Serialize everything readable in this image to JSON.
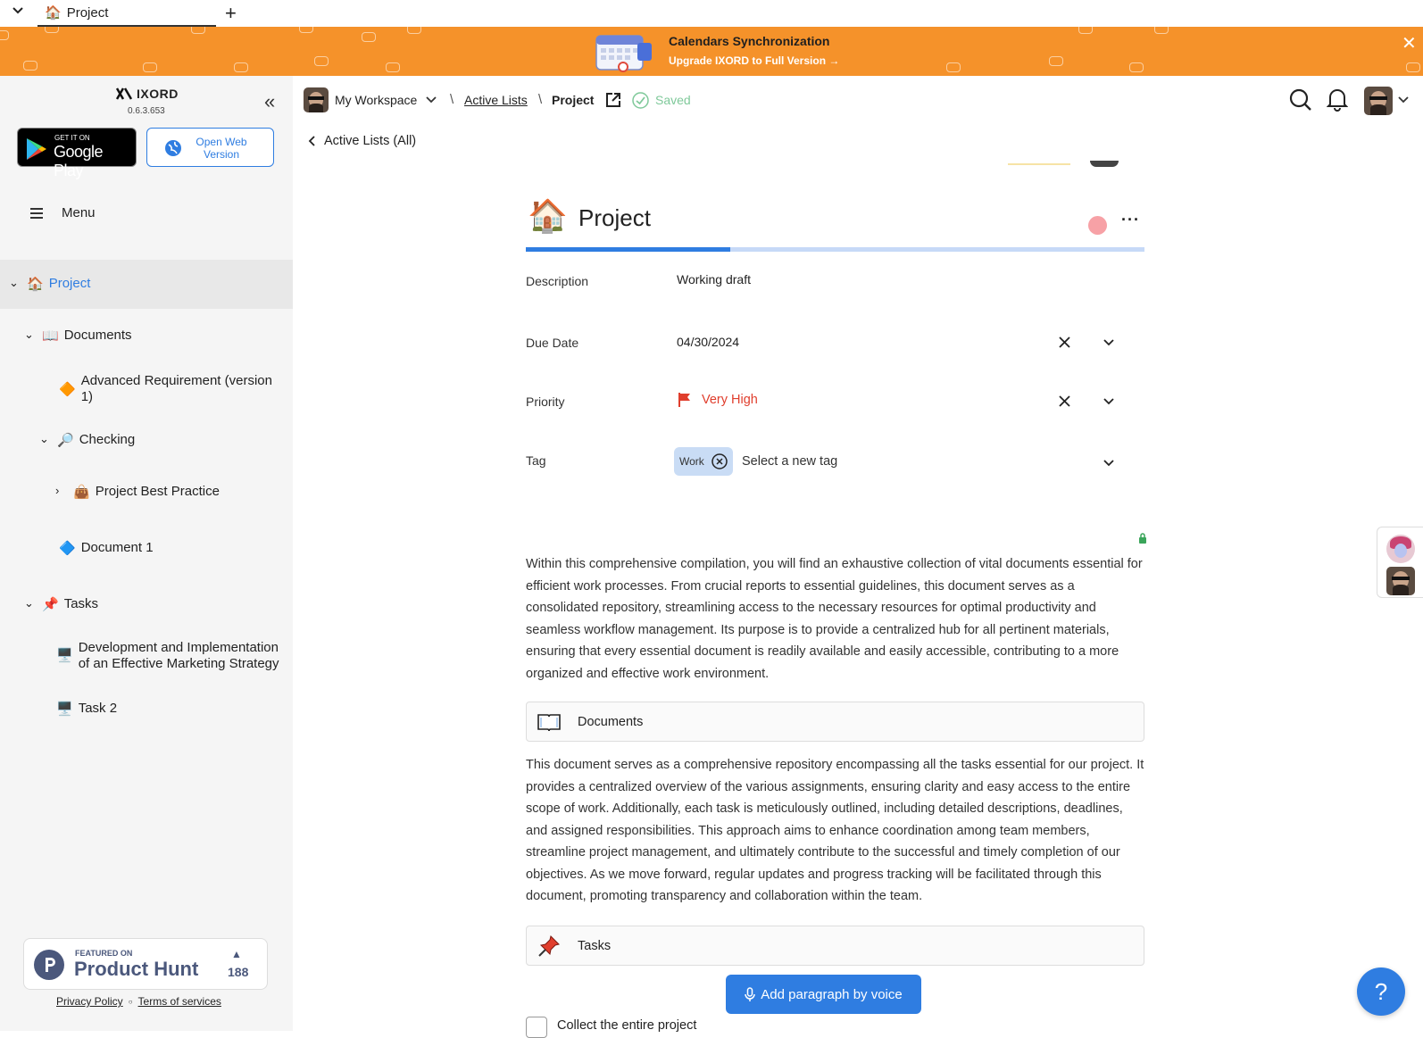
{
  "tab": {
    "icon": "house-emoji",
    "title": "Project",
    "new_tab": "+",
    "dropdown": "⌄"
  },
  "banner": {
    "title": "Calendars Synchronization",
    "subtitle": "Upgrade IXORD to Full Version",
    "color": "#f5922a"
  },
  "sidebar": {
    "app_name": "IXORD",
    "version": "0.6.3.653",
    "google_play_top": "GET IT ON",
    "google_play_bottom": "Google Play",
    "open_web_line1": "Open Web",
    "open_web_line2": "Version",
    "menu_label": "Menu",
    "tree": {
      "project": "Project",
      "documents": "Documents",
      "advanced_req": "Advanced Requirement (version 1)",
      "checking": "Checking",
      "best_practice": "Project Best Practice",
      "document1": "Document 1",
      "tasks": "Tasks",
      "dev_impl": "Development and Implementation of an Effective Marketing Strategy",
      "task2": "Task 2"
    },
    "product_hunt": {
      "featured": "FEATURED ON",
      "name": "Product Hunt",
      "votes": "188"
    },
    "privacy": "Privacy Policy",
    "terms": "Terms of services"
  },
  "topnav": {
    "workspace": "My Workspace",
    "sep": "\\",
    "active_lists": "Active Lists",
    "current": "Project",
    "saved": "Saved",
    "back_label": "Active Lists (All)"
  },
  "document": {
    "title": "Project",
    "progress": 0.33,
    "fields": {
      "description_label": "Description",
      "description_value": "Working draft",
      "due_label": "Due Date",
      "due_value": "04/30/2024",
      "priority_label": "Priority",
      "priority_value": "Very High",
      "tag_label": "Tag",
      "tag_chip": "Work",
      "tag_placeholder": "Select a new tag"
    },
    "para1": "Within this comprehensive compilation, you will find an exhaustive collection of vital documents essential for efficient work processes. From crucial reports to essential guidelines, this document serves as a consolidated repository, streamlining access to the necessary resources for optimal productivity and seamless workflow management. Its purpose is to provide a centralized hub for all pertinent materials, ensuring that every essential document is readily available and easily accessible, contributing to a more organized and effective work environment.",
    "block1": "Documents",
    "para2": "This document serves as a comprehensive repository encompassing all the tasks essential for our project. It provides a centralized overview of the various assignments, ensuring clarity and easy access to the entire scope of work. Additionally, each task is meticulously outlined, including detailed descriptions, deadlines, and assigned responsibilities. This approach aims to enhance coordination among team members, streamline project management, and ultimately contribute to the successful and timely completion of our objectives. As we move forward, regular updates and progress tracking will be facilitated through this document, promoting transparency and collaboration within the team.",
    "block2": "Tasks",
    "voice_button": "Add paragraph by voice",
    "collect_label": "Collect the entire project"
  },
  "help": "?",
  "colors": {
    "accent": "#2f7de1",
    "priority": "#e03e2d",
    "saved": "#7fc99a"
  }
}
